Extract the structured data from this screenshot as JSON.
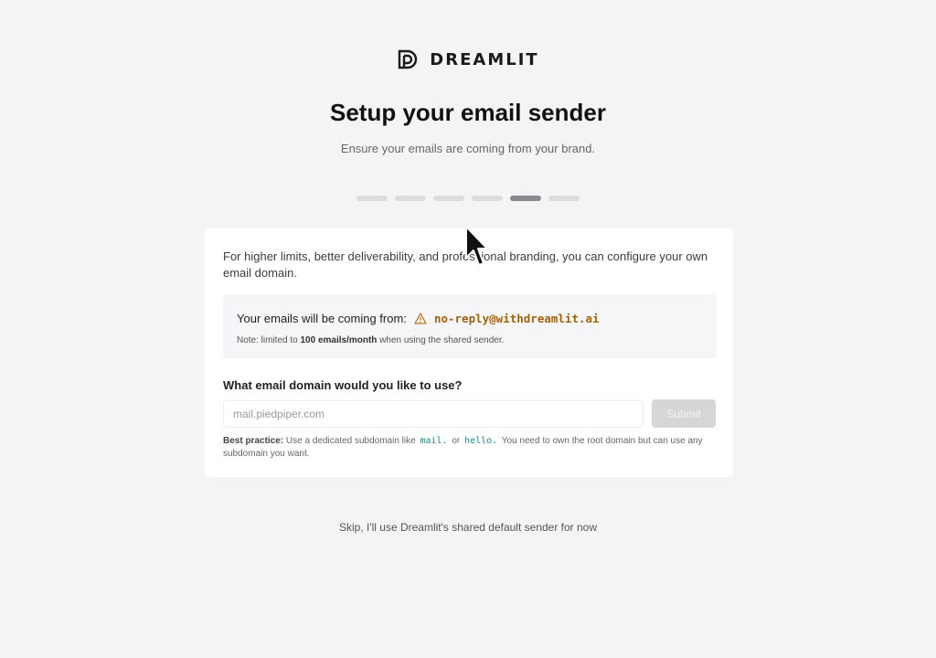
{
  "brand": {
    "name": "DREAMLIT",
    "logo_icon": "dreamlit-d-logo-icon"
  },
  "header": {
    "title": "Setup your email sender",
    "subtitle": "Ensure your emails are coming from your brand."
  },
  "stepper": {
    "total_steps": 6,
    "current_step": 5
  },
  "card": {
    "intro": "For higher limits, better deliverability, and professional branding, you can configure your own email domain.",
    "sender_label": "Your emails will be coming from:",
    "sender_icon": "warning-icon",
    "sender_address": "no-reply@withdreamlit.ai",
    "note_prefix": "Note: limited to",
    "note_bold": "100 emails/month",
    "note_suffix": "when using the shared sender.",
    "question": "What email domain would you like to use?",
    "input_value": "",
    "input_placeholder": "mail.piedpiper.com",
    "submit_label": "Submit",
    "hint_bold": "Best practice:",
    "hint_text_1": "Use a dedicated subdomain like",
    "hint_code_1": "mail.",
    "hint_or": "or",
    "hint_code_2": "hello.",
    "hint_text_2": "You need to own the root domain but can use any subdomain you want."
  },
  "skip_link": "Skip, I'll use Dreamlit's shared default sender for now",
  "colors": {
    "background": "#f4f4f5",
    "step_active": "#8a8a8e",
    "step_inactive": "#dcdcde",
    "sender_address": "#a0620a",
    "code": "#1f8a8a",
    "submit_disabled": "#d6d6d9"
  }
}
